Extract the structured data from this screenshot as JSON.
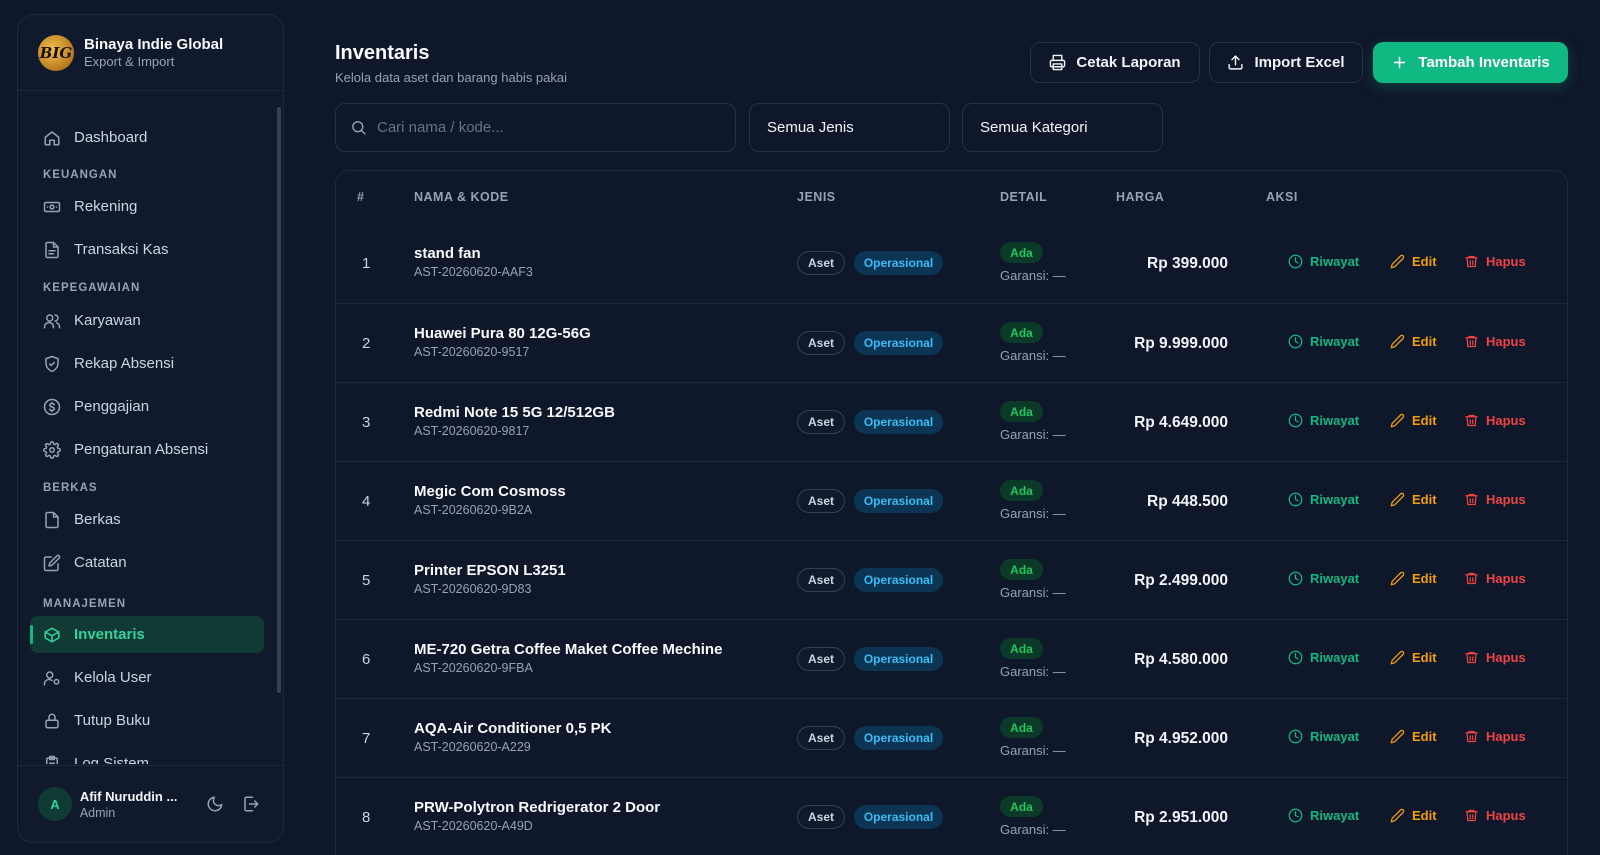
{
  "brand": {
    "logo_text": "BIG",
    "name": "Binaya Indie Global",
    "subtitle": "Export & Import"
  },
  "sidebar": {
    "dashboard": "Dashboard",
    "sections": {
      "keuangan": "KEUANGAN",
      "kepegawaian": "KEPEGAWAIAN",
      "berkas": "BERKAS",
      "manajemen": "MANAJEMEN"
    },
    "items": {
      "rekening": "Rekening",
      "transaksi_kas": "Transaksi Kas",
      "karyawan": "Karyawan",
      "rekap_absensi": "Rekap Absensi",
      "penggajian": "Penggajian",
      "pengaturan_absensi": "Pengaturan Absensi",
      "berkas": "Berkas",
      "catatan": "Catatan",
      "inventaris": "Inventaris",
      "kelola_user": "Kelola User",
      "tutup_buku": "Tutup Buku",
      "log_sistem": "Log Sistem"
    },
    "active": "inventaris",
    "accent": "#10b981"
  },
  "user": {
    "initial": "A",
    "name": "Afif Nuruddin ...",
    "role": "Admin"
  },
  "header": {
    "title": "Inventaris",
    "subtitle": "Kelola data aset dan barang habis pakai"
  },
  "actions": {
    "print": "Cetak Laporan",
    "import": "Import Excel",
    "add": "Tambah Inventaris"
  },
  "filters": {
    "search_placeholder": "Cari nama / kode...",
    "jenis": "Semua Jenis",
    "kategori": "Semua Kategori"
  },
  "table": {
    "columns": {
      "no": "#",
      "nama": "NAMA & KODE",
      "jenis": "JENIS",
      "detail": "DETAIL",
      "harga": "HARGA",
      "aksi": "AKSI"
    },
    "action_labels": {
      "riwayat": "Riwayat",
      "edit": "Edit",
      "hapus": "Hapus"
    },
    "rows": [
      {
        "no": "1",
        "name": "stand fan",
        "code": "AST-20260620-AAF3",
        "type": "Aset",
        "category": "Operasional",
        "status": "Ada",
        "warranty": "Garansi: —",
        "price": "Rp 399.000"
      },
      {
        "no": "2",
        "name": "Huawei Pura 80 12G-56G",
        "code": "AST-20260620-9517",
        "type": "Aset",
        "category": "Operasional",
        "status": "Ada",
        "warranty": "Garansi: —",
        "price": "Rp 9.999.000"
      },
      {
        "no": "3",
        "name": "Redmi Note 15 5G 12/512GB",
        "code": "AST-20260620-9817",
        "type": "Aset",
        "category": "Operasional",
        "status": "Ada",
        "warranty": "Garansi: —",
        "price": "Rp 4.649.000"
      },
      {
        "no": "4",
        "name": "Megic Com Cosmoss",
        "code": "AST-20260620-9B2A",
        "type": "Aset",
        "category": "Operasional",
        "status": "Ada",
        "warranty": "Garansi: —",
        "price": "Rp 448.500"
      },
      {
        "no": "5",
        "name": "Printer EPSON L3251",
        "code": "AST-20260620-9D83",
        "type": "Aset",
        "category": "Operasional",
        "status": "Ada",
        "warranty": "Garansi: —",
        "price": "Rp 2.499.000"
      },
      {
        "no": "6",
        "name": "ME-720 Getra Coffee Maket Coffee Mechine",
        "code": "AST-20260620-9FBA",
        "type": "Aset",
        "category": "Operasional",
        "status": "Ada",
        "warranty": "Garansi: —",
        "price": "Rp 4.580.000"
      },
      {
        "no": "7",
        "name": "AQA-Air Conditioner 0,5 PK",
        "code": "AST-20260620-A229",
        "type": "Aset",
        "category": "Operasional",
        "status": "Ada",
        "warranty": "Garansi: —",
        "price": "Rp 4.952.000"
      },
      {
        "no": "8",
        "name": "PRW-Polytron Redrigerator 2 Door",
        "code": "AST-20260620-A49D",
        "type": "Aset",
        "category": "Operasional",
        "status": "Ada",
        "warranty": "Garansi: —",
        "price": "Rp 2.951.000"
      }
    ]
  }
}
